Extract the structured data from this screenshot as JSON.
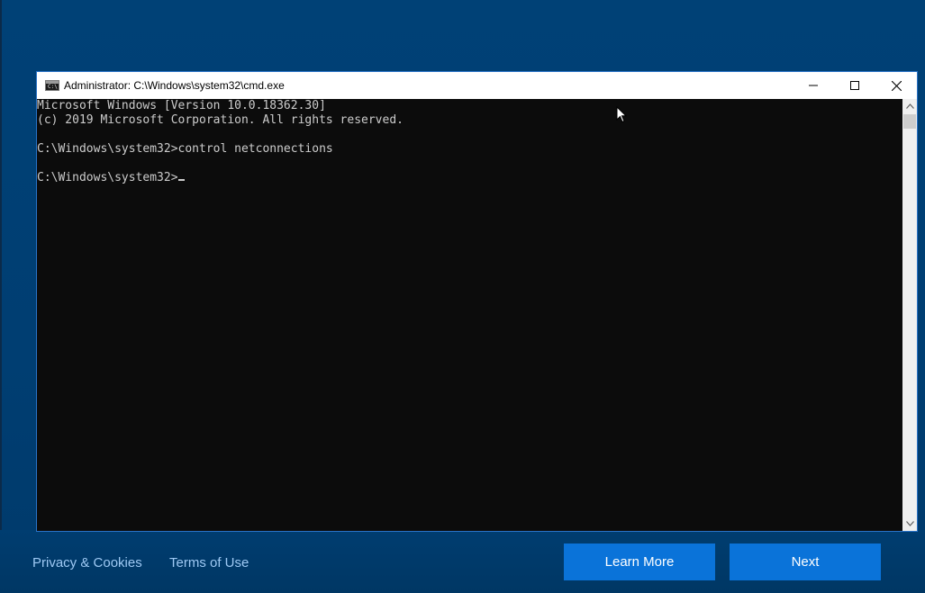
{
  "window": {
    "title": "Administrator: C:\\Windows\\system32\\cmd.exe",
    "icon": "cmd-app-icon",
    "controls": [
      "minimize-icon",
      "maximize-icon",
      "close-icon"
    ]
  },
  "console": {
    "lines": [
      "Microsoft Windows [Version 10.0.18362.30]",
      "(c) 2019 Microsoft Corporation. All rights reserved.",
      "",
      "C:\\Windows\\system32>control netconnections",
      "",
      "C:\\Windows\\system32>"
    ],
    "colors": {
      "background": "#0c0c0c",
      "text": "#cccccc"
    }
  },
  "footer": {
    "links": [
      {
        "label": "Privacy & Cookies"
      },
      {
        "label": "Terms of Use"
      }
    ],
    "buttons": [
      {
        "label": "Learn More"
      },
      {
        "label": "Next"
      }
    ]
  },
  "colors": {
    "desktop_background": "#004176",
    "accent_button": "#0a73d9",
    "link": "#9ec9f4"
  }
}
